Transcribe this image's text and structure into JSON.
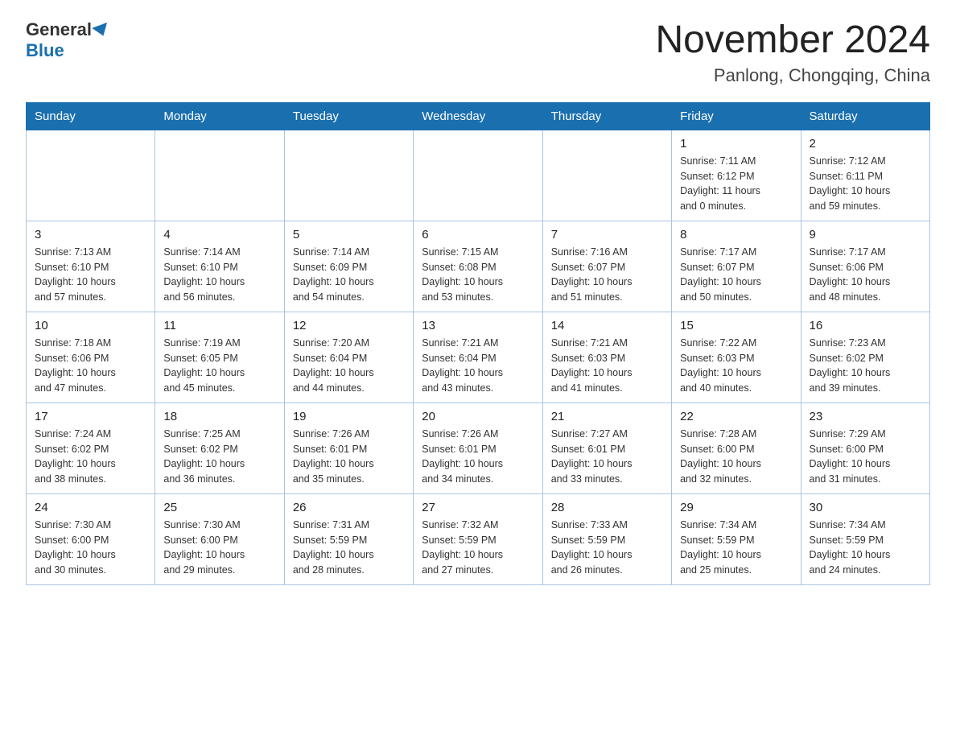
{
  "header": {
    "logo_general": "General",
    "logo_blue": "Blue",
    "month_title": "November 2024",
    "location": "Panlong, Chongqing, China"
  },
  "days_of_week": [
    "Sunday",
    "Monday",
    "Tuesday",
    "Wednesday",
    "Thursday",
    "Friday",
    "Saturday"
  ],
  "weeks": [
    [
      {
        "day": "",
        "info": ""
      },
      {
        "day": "",
        "info": ""
      },
      {
        "day": "",
        "info": ""
      },
      {
        "day": "",
        "info": ""
      },
      {
        "day": "",
        "info": ""
      },
      {
        "day": "1",
        "info": "Sunrise: 7:11 AM\nSunset: 6:12 PM\nDaylight: 11 hours\nand 0 minutes."
      },
      {
        "day": "2",
        "info": "Sunrise: 7:12 AM\nSunset: 6:11 PM\nDaylight: 10 hours\nand 59 minutes."
      }
    ],
    [
      {
        "day": "3",
        "info": "Sunrise: 7:13 AM\nSunset: 6:10 PM\nDaylight: 10 hours\nand 57 minutes."
      },
      {
        "day": "4",
        "info": "Sunrise: 7:14 AM\nSunset: 6:10 PM\nDaylight: 10 hours\nand 56 minutes."
      },
      {
        "day": "5",
        "info": "Sunrise: 7:14 AM\nSunset: 6:09 PM\nDaylight: 10 hours\nand 54 minutes."
      },
      {
        "day": "6",
        "info": "Sunrise: 7:15 AM\nSunset: 6:08 PM\nDaylight: 10 hours\nand 53 minutes."
      },
      {
        "day": "7",
        "info": "Sunrise: 7:16 AM\nSunset: 6:07 PM\nDaylight: 10 hours\nand 51 minutes."
      },
      {
        "day": "8",
        "info": "Sunrise: 7:17 AM\nSunset: 6:07 PM\nDaylight: 10 hours\nand 50 minutes."
      },
      {
        "day": "9",
        "info": "Sunrise: 7:17 AM\nSunset: 6:06 PM\nDaylight: 10 hours\nand 48 minutes."
      }
    ],
    [
      {
        "day": "10",
        "info": "Sunrise: 7:18 AM\nSunset: 6:06 PM\nDaylight: 10 hours\nand 47 minutes."
      },
      {
        "day": "11",
        "info": "Sunrise: 7:19 AM\nSunset: 6:05 PM\nDaylight: 10 hours\nand 45 minutes."
      },
      {
        "day": "12",
        "info": "Sunrise: 7:20 AM\nSunset: 6:04 PM\nDaylight: 10 hours\nand 44 minutes."
      },
      {
        "day": "13",
        "info": "Sunrise: 7:21 AM\nSunset: 6:04 PM\nDaylight: 10 hours\nand 43 minutes."
      },
      {
        "day": "14",
        "info": "Sunrise: 7:21 AM\nSunset: 6:03 PM\nDaylight: 10 hours\nand 41 minutes."
      },
      {
        "day": "15",
        "info": "Sunrise: 7:22 AM\nSunset: 6:03 PM\nDaylight: 10 hours\nand 40 minutes."
      },
      {
        "day": "16",
        "info": "Sunrise: 7:23 AM\nSunset: 6:02 PM\nDaylight: 10 hours\nand 39 minutes."
      }
    ],
    [
      {
        "day": "17",
        "info": "Sunrise: 7:24 AM\nSunset: 6:02 PM\nDaylight: 10 hours\nand 38 minutes."
      },
      {
        "day": "18",
        "info": "Sunrise: 7:25 AM\nSunset: 6:02 PM\nDaylight: 10 hours\nand 36 minutes."
      },
      {
        "day": "19",
        "info": "Sunrise: 7:26 AM\nSunset: 6:01 PM\nDaylight: 10 hours\nand 35 minutes."
      },
      {
        "day": "20",
        "info": "Sunrise: 7:26 AM\nSunset: 6:01 PM\nDaylight: 10 hours\nand 34 minutes."
      },
      {
        "day": "21",
        "info": "Sunrise: 7:27 AM\nSunset: 6:01 PM\nDaylight: 10 hours\nand 33 minutes."
      },
      {
        "day": "22",
        "info": "Sunrise: 7:28 AM\nSunset: 6:00 PM\nDaylight: 10 hours\nand 32 minutes."
      },
      {
        "day": "23",
        "info": "Sunrise: 7:29 AM\nSunset: 6:00 PM\nDaylight: 10 hours\nand 31 minutes."
      }
    ],
    [
      {
        "day": "24",
        "info": "Sunrise: 7:30 AM\nSunset: 6:00 PM\nDaylight: 10 hours\nand 30 minutes."
      },
      {
        "day": "25",
        "info": "Sunrise: 7:30 AM\nSunset: 6:00 PM\nDaylight: 10 hours\nand 29 minutes."
      },
      {
        "day": "26",
        "info": "Sunrise: 7:31 AM\nSunset: 5:59 PM\nDaylight: 10 hours\nand 28 minutes."
      },
      {
        "day": "27",
        "info": "Sunrise: 7:32 AM\nSunset: 5:59 PM\nDaylight: 10 hours\nand 27 minutes."
      },
      {
        "day": "28",
        "info": "Sunrise: 7:33 AM\nSunset: 5:59 PM\nDaylight: 10 hours\nand 26 minutes."
      },
      {
        "day": "29",
        "info": "Sunrise: 7:34 AM\nSunset: 5:59 PM\nDaylight: 10 hours\nand 25 minutes."
      },
      {
        "day": "30",
        "info": "Sunrise: 7:34 AM\nSunset: 5:59 PM\nDaylight: 10 hours\nand 24 minutes."
      }
    ]
  ]
}
